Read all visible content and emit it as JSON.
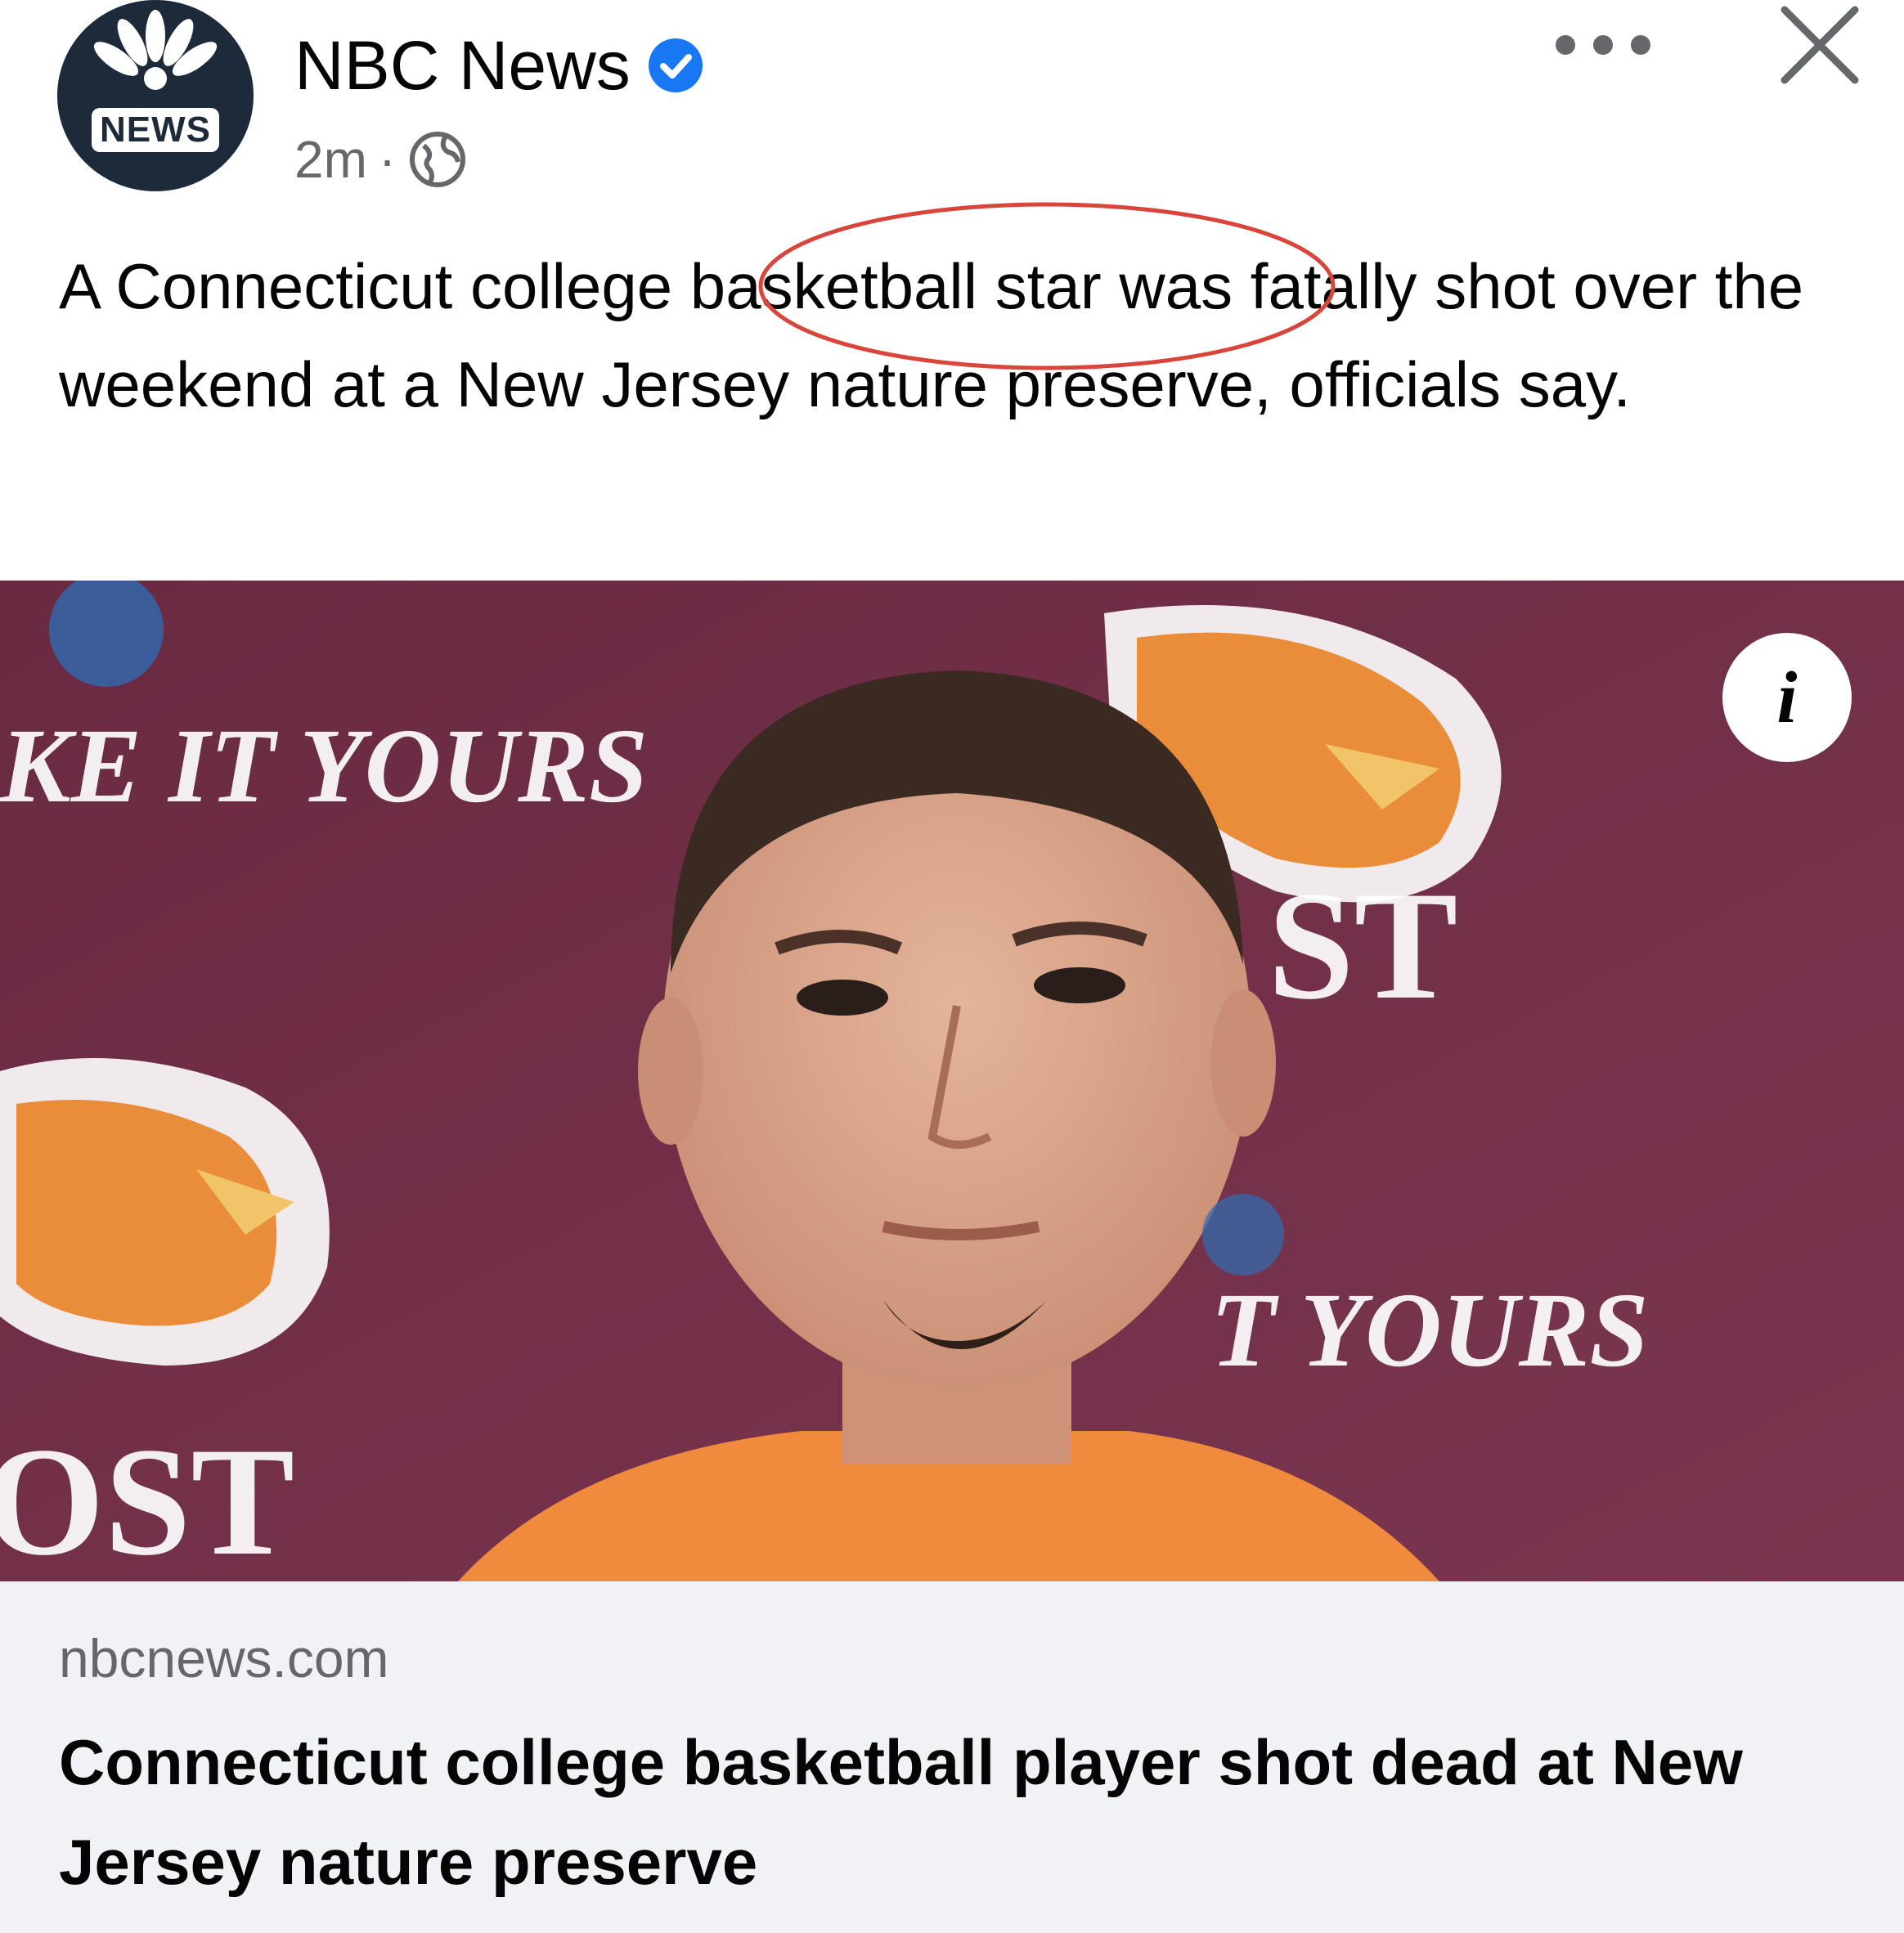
{
  "post": {
    "page_name": "NBC News",
    "avatar_text": "NEWS",
    "time": "2m",
    "separator": "·",
    "audience_icon": "globe-icon",
    "verified_icon": "verified-badge-icon",
    "caption": "A Connecticut college basketball star was fatally shot over the weekend at a New Jersey nature preserve, officials say.",
    "highlighted_phrase": "basketball star"
  },
  "image": {
    "banner_text_top": "KE IT YOURS",
    "banner_text_right": "T YOURS",
    "logo_text_right": "ST",
    "logo_text_left": "OST",
    "info_label": "i"
  },
  "link": {
    "domain": "nbcnews.com",
    "title": "Connecticut college basketball player shot dead at New Jersey nature preserve"
  },
  "colors": {
    "verified_blue": "#1877f2",
    "annotation_red": "#d9453a",
    "backdrop_maroon": "#6e2d45",
    "jersey_orange": "#f08a3c",
    "card_bg": "#f0f2f5"
  }
}
